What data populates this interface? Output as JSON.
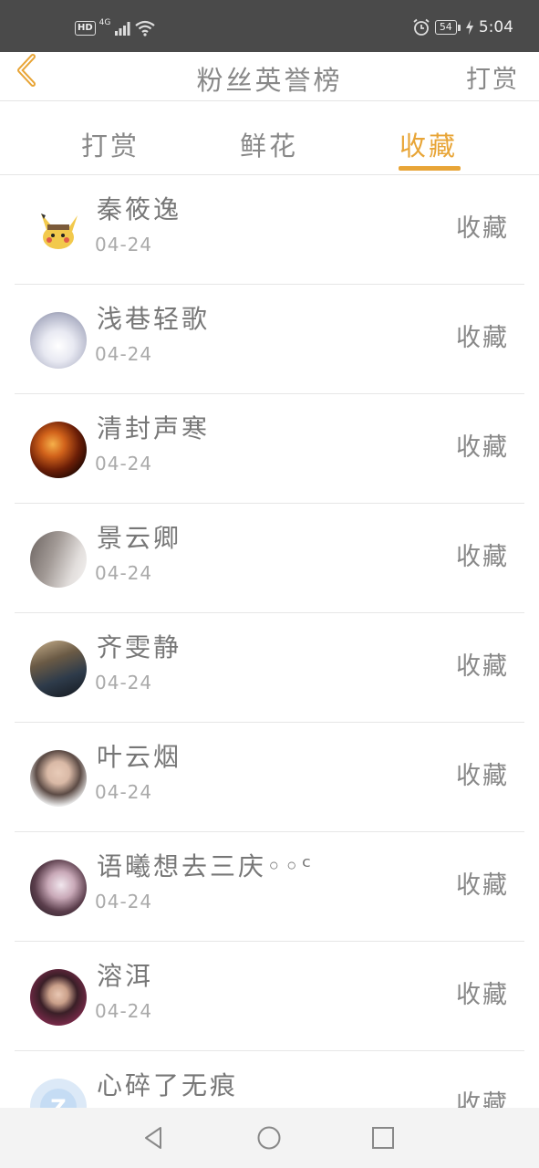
{
  "status_bar": {
    "hd": "HD",
    "network": "4G",
    "battery": "54",
    "time": "5:04"
  },
  "header": {
    "title": "粉丝英誉榜",
    "right_action": "打赏"
  },
  "tabs": [
    {
      "label": "打赏",
      "active": false
    },
    {
      "label": "鲜花",
      "active": false
    },
    {
      "label": "收藏",
      "active": true
    }
  ],
  "accent_color": "#e8a537",
  "list": [
    {
      "name": "秦筱逸",
      "date": "04-24",
      "action": "收藏",
      "avatar": "pikachu-avatar"
    },
    {
      "name": "浅巷轻歌",
      "date": "04-24",
      "action": "收藏",
      "avatar": "white-dress-avatar"
    },
    {
      "name": "清封声寒",
      "date": "04-24",
      "action": "收藏",
      "avatar": "fire-avatar"
    },
    {
      "name": "景云卿",
      "date": "04-24",
      "action": "收藏",
      "avatar": "person-avatar"
    },
    {
      "name": "齐雯静",
      "date": "04-24",
      "action": "收藏",
      "avatar": "street-avatar"
    },
    {
      "name": "叶云烟",
      "date": "04-24",
      "action": "收藏",
      "avatar": "girl-avatar"
    },
    {
      "name": "语曦想去三庆◦◦ᶜ",
      "date": "04-24",
      "action": "收藏",
      "avatar": "girl-dark-avatar"
    },
    {
      "name": "溶洱",
      "date": "04-24",
      "action": "收藏",
      "avatar": "woman-avatar"
    },
    {
      "name": "心碎了无痕",
      "date": "",
      "action": "收藏",
      "avatar": "default-avatar"
    }
  ]
}
